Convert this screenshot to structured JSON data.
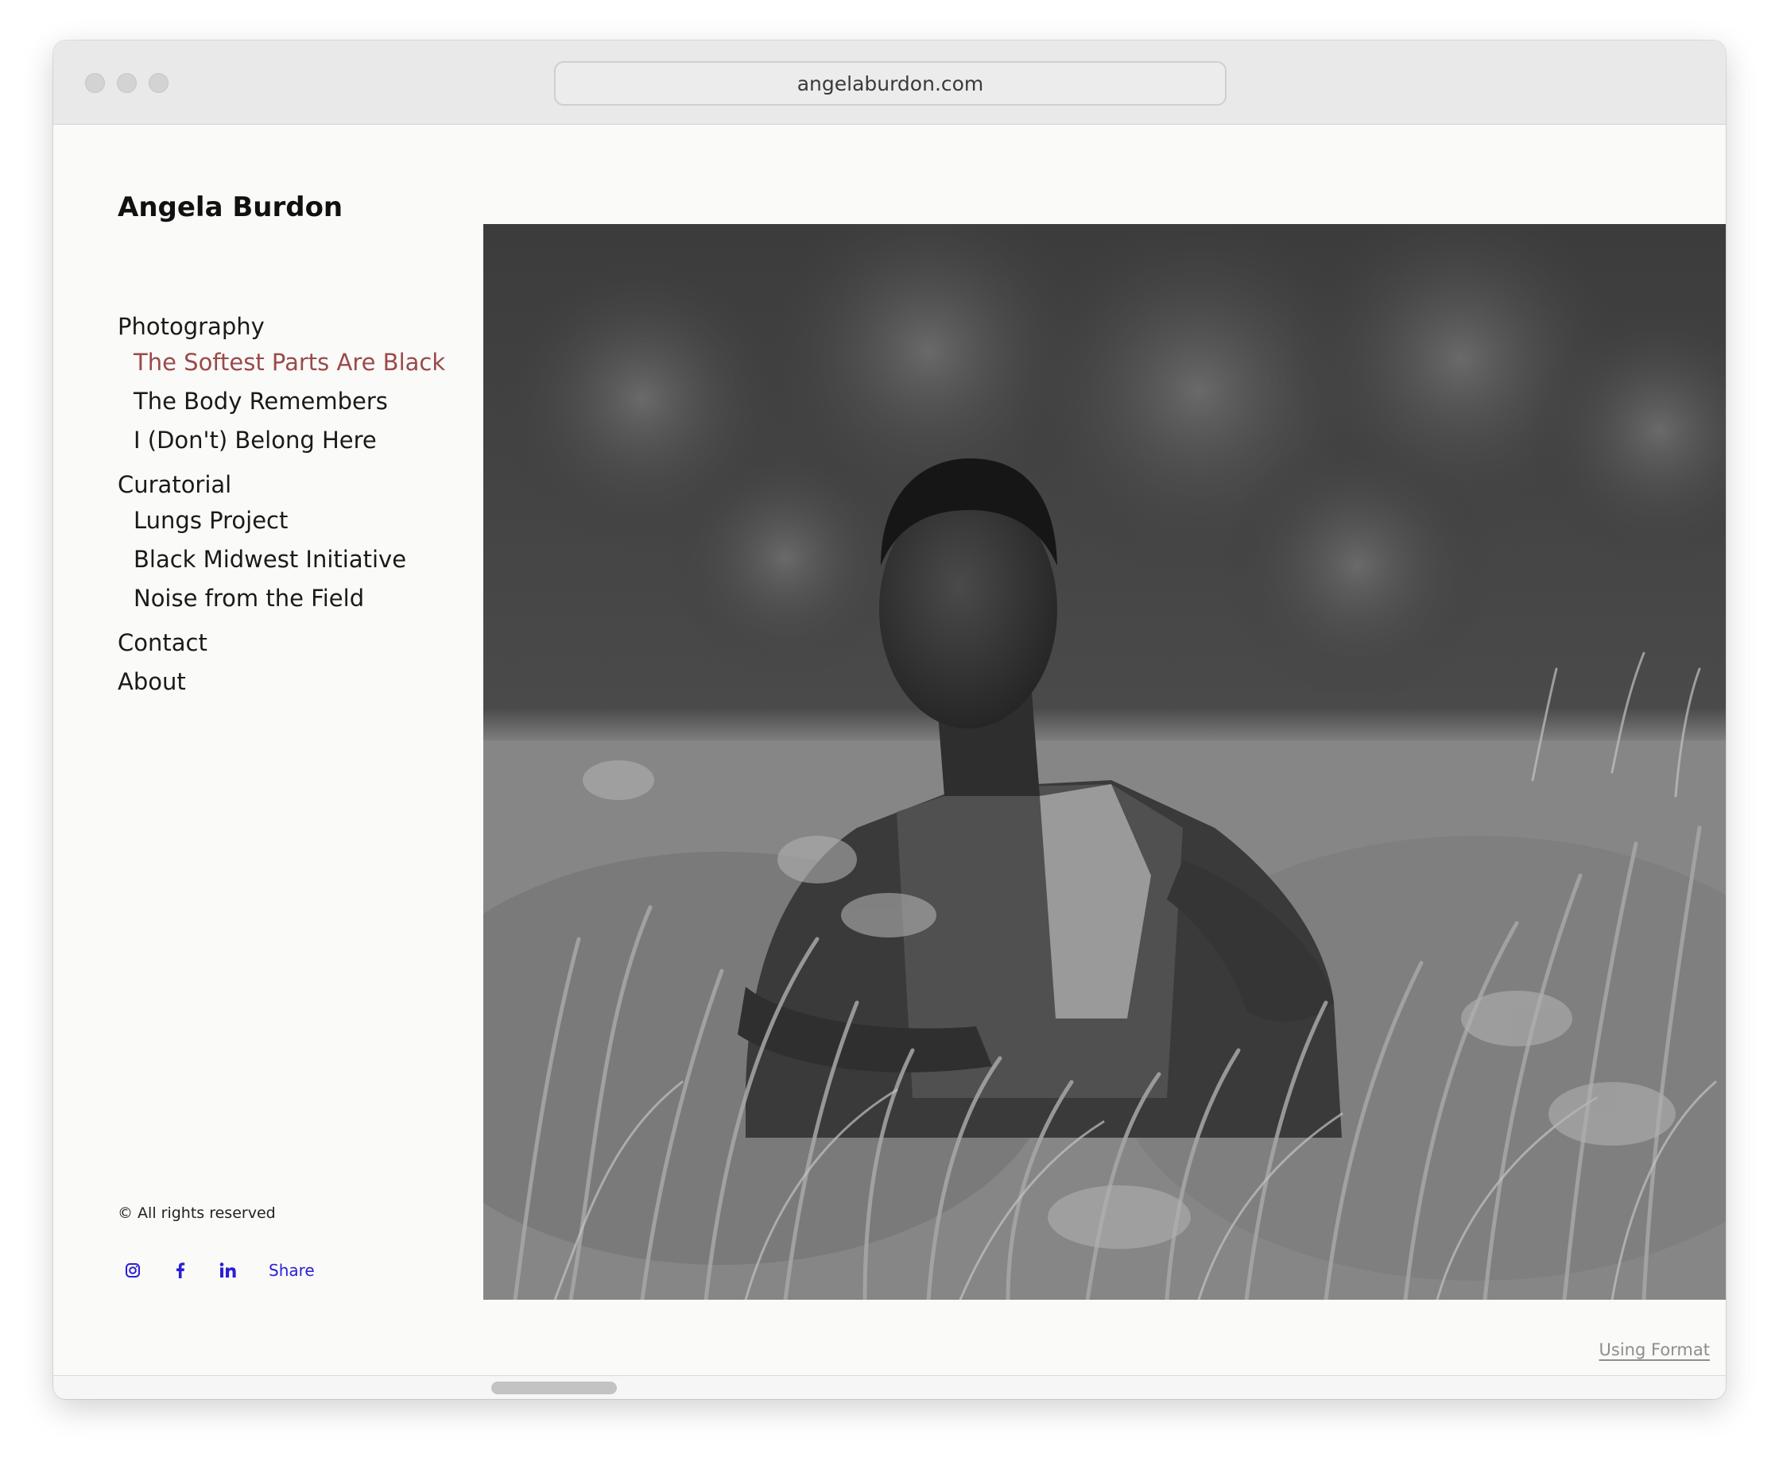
{
  "browser": {
    "url": "angelaburdon.com"
  },
  "site": {
    "title": "Angela Burdon"
  },
  "nav": [
    {
      "label": "Photography",
      "level": "top"
    },
    {
      "label": "The Softest Parts Are Black",
      "level": "sub",
      "active": true
    },
    {
      "label": "The Body Remembers",
      "level": "sub"
    },
    {
      "label": "I (Don't) Belong Here",
      "level": "sub"
    },
    {
      "label": "Curatorial",
      "level": "top"
    },
    {
      "label": "Lungs Project",
      "level": "sub"
    },
    {
      "label": "Black Midwest Initiative",
      "level": "sub"
    },
    {
      "label": "Noise from the Field",
      "level": "sub"
    },
    {
      "label": "Contact",
      "level": "top"
    },
    {
      "label": "About",
      "level": "top"
    }
  ],
  "footer": {
    "copyright": "© All rights reserved",
    "share_label": "Share",
    "social_icons": [
      "instagram-icon",
      "facebook-icon",
      "linkedin-icon"
    ],
    "credit": "Using Format"
  },
  "colors": {
    "active_nav": "#9a4a4a",
    "social_link": "#2b1ed6",
    "page_bg": "#fafaf8"
  }
}
